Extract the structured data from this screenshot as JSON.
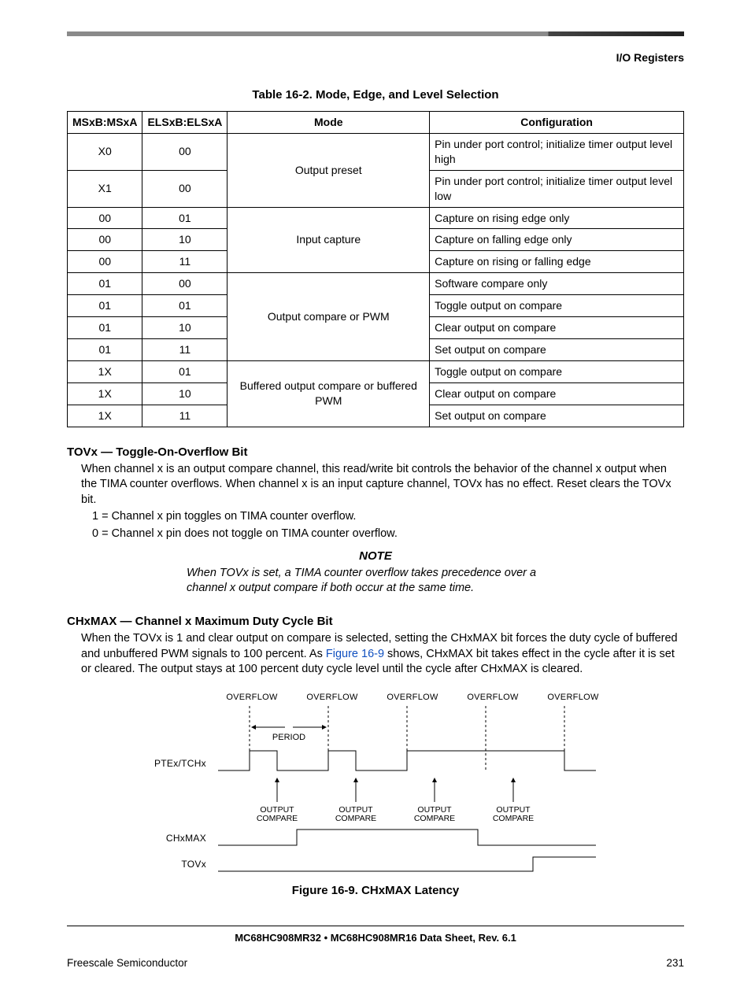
{
  "header": {
    "section": "I/O Registers"
  },
  "table": {
    "title": "Table 16-2. Mode, Edge, and Level Selection",
    "cols": {
      "c1": "MSxB:MSxA",
      "c2": "ELSxB:ELSxA",
      "c3": "Mode",
      "c4": "Configuration"
    },
    "groups": [
      {
        "mode": "Output preset",
        "rows": [
          {
            "ms": "X0",
            "els": "00",
            "cfg": "Pin under port control; initialize timer output level high"
          },
          {
            "ms": "X1",
            "els": "00",
            "cfg": "Pin under port control; initialize timer output level low"
          }
        ]
      },
      {
        "mode": "Input capture",
        "rows": [
          {
            "ms": "00",
            "els": "01",
            "cfg": "Capture on rising edge only"
          },
          {
            "ms": "00",
            "els": "10",
            "cfg": "Capture on falling edge only"
          },
          {
            "ms": "00",
            "els": "11",
            "cfg": "Capture on rising or falling edge"
          }
        ]
      },
      {
        "mode": "Output compare or PWM",
        "rows": [
          {
            "ms": "01",
            "els": "00",
            "cfg": "Software compare only"
          },
          {
            "ms": "01",
            "els": "01",
            "cfg": "Toggle output on compare"
          },
          {
            "ms": "01",
            "els": "10",
            "cfg": "Clear output on compare"
          },
          {
            "ms": "01",
            "els": "11",
            "cfg": "Set output on compare"
          }
        ]
      },
      {
        "mode": "Buffered output compare or buffered PWM",
        "rows": [
          {
            "ms": "1X",
            "els": "01",
            "cfg": "Toggle output on compare"
          },
          {
            "ms": "1X",
            "els": "10",
            "cfg": "Clear output on compare"
          },
          {
            "ms": "1X",
            "els": "11",
            "cfg": "Set output on compare"
          }
        ]
      }
    ]
  },
  "tovx": {
    "title": "TOVx — Toggle-On-Overflow Bit",
    "body": "When channel x is an output compare channel, this read/write bit controls the behavior of the channel x output when the TIMA counter overflows. When channel x is an input capture channel, TOVx has no effect. Reset clears the TOVx bit.",
    "v1": "1 = Channel x pin toggles on TIMA counter overflow.",
    "v0": "0 = Channel x pin does not toggle on TIMA counter overflow."
  },
  "note": {
    "hdr": "NOTE",
    "body": "When TOVx is set, a TIMA counter overflow takes precedence over a channel x output compare if both occur at the same time."
  },
  "chxmax": {
    "title": "CHxMAX — Channel x Maximum Duty Cycle Bit",
    "body1": "When the TOVx is 1 and clear output on compare is selected, setting the CHxMAX bit forces the duty cycle of buffered and unbuffered PWM signals to 100 percent. As ",
    "link": "Figure 16-9",
    "body2": " shows, CHxMAX bit takes effect in the cycle after it is set or cleared. The output stays at 100 percent duty cycle level until the cycle after CHxMAX is cleared."
  },
  "figure": {
    "ovf": "OVERFLOW",
    "period": "PERIOD",
    "sig1": "PTEx/TCHx",
    "sig2": "CHxMAX",
    "sig3": "TOVx",
    "oc": "OUTPUT COMPARE",
    "title": "Figure 16-9. CHxMAX Latency"
  },
  "footer": {
    "doc": "MC68HC908MR32 • MC68HC908MR16 Data Sheet, Rev. 6.1",
    "vendor": "Freescale Semiconductor",
    "page": "231"
  }
}
